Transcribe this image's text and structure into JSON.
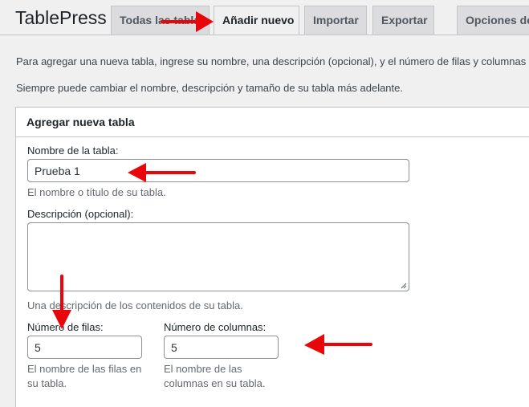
{
  "app": {
    "title": "TablePress"
  },
  "tabs": [
    {
      "label": "Todas las tablas",
      "active": false
    },
    {
      "label": "Añadir nuevo",
      "active": true
    },
    {
      "label": "Importar",
      "active": false
    },
    {
      "label": "Exportar",
      "active": false
    },
    {
      "label": "Opciones de",
      "active": false
    }
  ],
  "intro": {
    "line1": "Para agregar una nueva tabla, ingrese su nombre, una descripción (opcional), y el número de filas y columnas en",
    "line2": "Siempre puede cambiar el nombre, descripción y tamaño de su tabla más adelante."
  },
  "form": {
    "header": "Agregar nueva tabla",
    "name": {
      "label": "Nombre de la tabla:",
      "value": "Prueba 1",
      "hint": "El nombre o título de su tabla."
    },
    "description": {
      "label": "Descripción (opcional):",
      "value": "",
      "hint": "Una descripción de los contenidos de su tabla."
    },
    "rows": {
      "label": "Número de filas:",
      "value": "5",
      "hint_line1": "El nombre de las filas en",
      "hint_line2": "su tabla."
    },
    "columns": {
      "label": "Número de columnas:",
      "value": "5",
      "hint_line1": "El nombre de las",
      "hint_line2": "columnas en su tabla."
    }
  },
  "colors": {
    "annotation_arrow": "#e8060a",
    "tab_background": "#dcdcde",
    "page_background": "#f0f0f1",
    "border": "#c3c4c7"
  }
}
